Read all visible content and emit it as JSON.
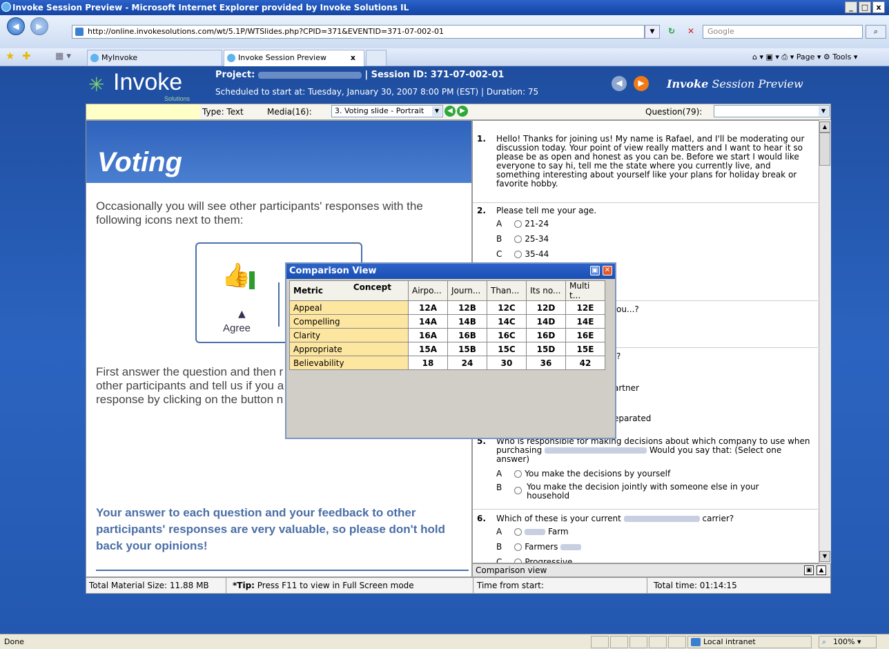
{
  "window": {
    "title": "Invoke Session Preview - Microsoft Internet Explorer provided by Invoke Solutions IL",
    "min": "_",
    "max": "□",
    "close": "x"
  },
  "browser": {
    "back": "◀",
    "forward": "▶",
    "url": "http://online.invokesolutions.com/wt/5.1P/WTSlides.php?CPID=371&EVENTID=371-07-002-01",
    "search_placeholder": "Google",
    "tabs": [
      {
        "label": "MyInvoke"
      },
      {
        "label": "Invoke Session Preview",
        "close": "x"
      }
    ],
    "tools": "⌂ ▾  ▣ ▾  ⎙ ▾  Page ▾  ⚙ Tools ▾"
  },
  "header": {
    "logo": "Invoke",
    "logo_sub": "Solutions",
    "project_label": "Project:",
    "session_label": "| Session ID: 371-07-002-01",
    "scheduled": "Scheduled to start at: Tuesday, January 30, 2007 8:00 PM (EST)   | Duration: 75",
    "preview_bold": "Invoke",
    "preview_rest": " Session Preview"
  },
  "toolbar": {
    "type": "Type: Text",
    "media": "Media(16):",
    "media_select": "3. Voting slide - Portrait",
    "question_label": "Question(79):"
  },
  "slide": {
    "title": "Voting",
    "para1": "Occasionally you will see other participants' responses with the following icons next to them:",
    "agree": "Agree",
    "para2": "First answer the question and then r other participants and tell us if you a response by clicking on the button n",
    "para3": "Your answer to each question and your feedback to other participants' responses are very valuable, so please don't hold back your opinions!"
  },
  "questions": {
    "q1_num": "1.",
    "q1": "Hello! Thanks for joining us! My name is Rafael, and I'll be moderating our discussion today. Your point of view really matters and I want to hear it so please be as open and honest as you can be. Before we start I would like everyone to say hi, tell me the state where you currently live, and something interesting about yourself like your plans for holiday break or favorite hobby.",
    "q2_num": "2.",
    "q2": "Please tell me your age.",
    "q2_opts": [
      {
        "letter": "A",
        "text": "21-24"
      },
      {
        "letter": "B",
        "text": "25-34"
      },
      {
        "letter": "C",
        "text": "35-44"
      }
    ],
    "frag_a": "ou...?",
    "frag_b": "?",
    "frag_c": "artner",
    "frag_d": "eparated",
    "q5_num": "5.",
    "q5_a": "Who is responsible for making decisions about which company to use when purchasing",
    "q5_b": "Would you say that: (Select one answer)",
    "q5_opts": [
      {
        "letter": "A",
        "text": "You make the decisions by yourself"
      },
      {
        "letter": "B",
        "text": "You make the decision jointly with someone else in your household"
      }
    ],
    "q6_num": "6.",
    "q6_a": "Which of these is your current",
    "q6_b": "carrier?",
    "q6_opts": [
      {
        "letter": "A",
        "text": "Farm"
      },
      {
        "letter": "B",
        "text": "Farmers"
      },
      {
        "letter": "C",
        "text": "Progressive"
      }
    ]
  },
  "comparison_bar": "Comparison view",
  "status": {
    "size": "Total Material Size: 11.88 MB",
    "tip_bold": "*Tip:",
    "tip": " Press F11 to view in Full Screen mode",
    "time_from_start": "Time from start:",
    "total_time": "Total time: 01:14:15"
  },
  "comparison": {
    "title": "Comparison View",
    "metric_header": "Metric",
    "concept_header": "Concept",
    "columns": [
      "Airpo...",
      "Journ...",
      "Than...",
      "Its no...",
      "Multi t..."
    ],
    "rows": [
      {
        "metric": "Appeal",
        "values": [
          "12A",
          "12B",
          "12C",
          "12D",
          "12E"
        ]
      },
      {
        "metric": "Compelling",
        "values": [
          "14A",
          "14B",
          "14C",
          "14D",
          "14E"
        ]
      },
      {
        "metric": "Clarity",
        "values": [
          "16A",
          "16B",
          "16C",
          "16D",
          "16E"
        ]
      },
      {
        "metric": "Appropriate",
        "values": [
          "15A",
          "15B",
          "15C",
          "15D",
          "15E"
        ]
      },
      {
        "metric": "Believability",
        "values": [
          "18",
          "24",
          "30",
          "36",
          "42"
        ]
      }
    ]
  },
  "ie_status": {
    "left": "Done",
    "zone": "Local intranet",
    "zoom": "100%"
  }
}
